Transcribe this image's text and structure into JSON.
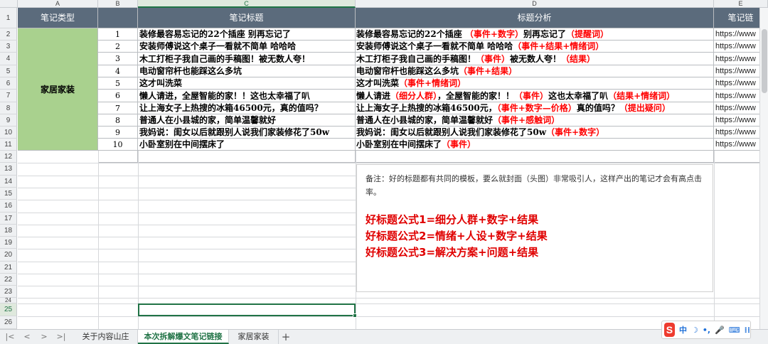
{
  "columns": [
    "A",
    "B",
    "C",
    "D",
    "E"
  ],
  "active_column": "C",
  "row_numbers": [
    "1",
    "2",
    "3",
    "4",
    "5",
    "6",
    "7",
    "8",
    "9",
    "10",
    "11",
    "12",
    "13",
    "14",
    "15",
    "16",
    "17",
    "18",
    "19",
    "20",
    "21",
    "22",
    "23",
    "24",
    "25",
    "26"
  ],
  "active_row": "25",
  "header": {
    "a": "笔记类型",
    "c": "笔记标题",
    "d": "标题分析",
    "e": "笔记链"
  },
  "category": "家居家装",
  "rows": [
    {
      "num": "1",
      "title": "装修最容易忘记的22个插座  别再忘记了",
      "analysis": [
        {
          "t": "装修最容易忘记的22个插座  "
        },
        {
          "t": "（事件+数字）",
          "red": true
        },
        {
          "t": "别再忘记了"
        },
        {
          "t": "（提醒词）",
          "red": true
        }
      ],
      "link": "https://www"
    },
    {
      "num": "2",
      "title": "安装师傅说这个桌子一看就不简单  哈哈哈",
      "analysis": [
        {
          "t": "安装师傅说这个桌子一看就不简单  哈哈哈"
        },
        {
          "t": "（事件+结果+情绪词）",
          "red": true
        }
      ],
      "link": "https://www"
    },
    {
      "num": "3",
      "title": "木工打柜子我自己画的手稿图！被无数人夸！",
      "analysis": [
        {
          "t": "木工打柜子我自己画的手稿图！"
        },
        {
          "t": "（事件）",
          "red": true
        },
        {
          "t": "被无数人夸！"
        },
        {
          "t": "（结果）",
          "red": true
        }
      ],
      "link": "https://www"
    },
    {
      "num": "4",
      "title": "电动窗帘杆也能踩这么多坑",
      "analysis": [
        {
          "t": "电动窗帘杆也能踩这么多坑"
        },
        {
          "t": "（事件+结果）",
          "red": true
        }
      ],
      "link": "https://www"
    },
    {
      "num": "5",
      "title": "这才叫洗菜",
      "analysis": [
        {
          "t": "这才叫洗菜"
        },
        {
          "t": "（事件+情绪词）",
          "red": true
        }
      ],
      "link": "https://www"
    },
    {
      "num": "6",
      "title": "懒人请进，全屋智能的家！！这也太幸福了叭",
      "analysis": [
        {
          "t": "懒人请进"
        },
        {
          "t": "（细分人群）",
          "red": true
        },
        {
          "t": "，全屋智能的家！！"
        },
        {
          "t": "（事件）",
          "red": true
        },
        {
          "t": "这也太幸福了叭"
        },
        {
          "t": "（结果+情绪词）",
          "red": true
        }
      ],
      "link": "https://www"
    },
    {
      "num": "7",
      "title": "让上海女子上热搜的冰箱46500元，真的值吗？",
      "analysis": [
        {
          "t": "让上海女子上热搜的冰箱46500元，"
        },
        {
          "t": "（事件+数字—价格）",
          "red": true
        },
        {
          "t": "真的值吗？"
        },
        {
          "t": "（提出疑问）",
          "red": true
        }
      ],
      "link": "https://www"
    },
    {
      "num": "8",
      "title": "普通人在小县城的家，简单温馨就好",
      "analysis": [
        {
          "t": "普通人在小县城的家，简单温馨就好"
        },
        {
          "t": "（事件+感触词）",
          "red": true
        }
      ],
      "link": "https://www"
    },
    {
      "num": "9",
      "title": "我妈说：闺女以后就跟别人说我们家装修花了50w",
      "analysis": [
        {
          "t": "我妈说：闺女以后就跟别人说我们家装修花了50w"
        },
        {
          "t": "（事件+数字）",
          "red": true
        }
      ],
      "link": "https://www"
    },
    {
      "num": "10",
      "title": "小卧室别在中间摆床了",
      "analysis": [
        {
          "t": "小卧室别在中间摆床了"
        },
        {
          "t": "（事件）",
          "red": true
        }
      ],
      "link": "https://www"
    }
  ],
  "note": {
    "text": "备注：好的标题都有共同的模板，要么就封面（头图）非常吸引人，这样产出的笔记才会有高点击率。",
    "formulas": [
      "好标题公式1=细分人群+数字+结果",
      "好标题公式2=情绪+人设+数字+结果",
      "好标题公式3=解决方案+问题+结果"
    ]
  },
  "tabs": [
    {
      "label": "关于内容山庄",
      "active": false
    },
    {
      "label": "本次拆解爆文笔记链接",
      "active": true
    },
    {
      "label": "家居家装",
      "active": false
    }
  ],
  "nav": [
    "|<",
    "<",
    ">",
    ">|"
  ],
  "add_tab": "+",
  "ime": {
    "logo": "S",
    "lang": "中",
    "moon": "☽",
    "dot": "•,",
    "mic": "🎤",
    "keyboard": "⌨",
    "grid": "⁞⁞"
  },
  "colors": {
    "header_bg": "#5b6b7c",
    "category_bg": "#a9d18e",
    "accent": "#217346",
    "red": "#ff0000"
  }
}
